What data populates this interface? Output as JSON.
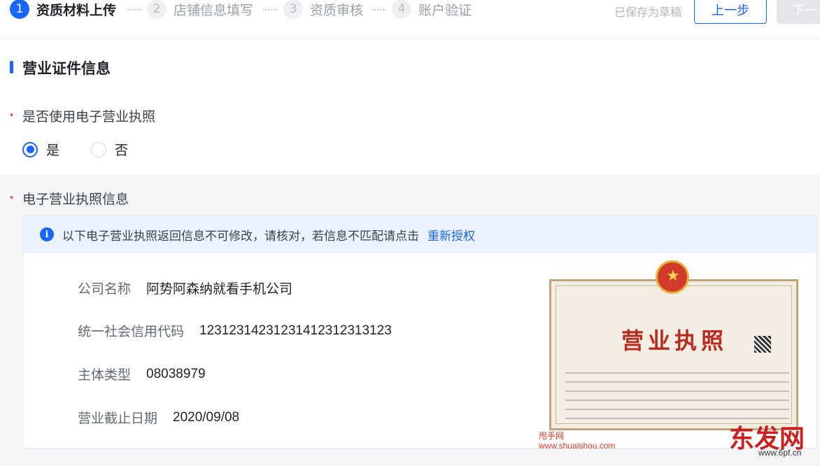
{
  "steps": [
    {
      "num": "1",
      "label": "资质材料上传"
    },
    {
      "num": "2",
      "label": "店铺信息填写"
    },
    {
      "num": "3",
      "label": "资质审核"
    },
    {
      "num": "4",
      "label": "账户验证"
    }
  ],
  "current_step": 1,
  "header": {
    "draft_text": "已保存为草稿",
    "prev_label": "上一步",
    "next_label": "下一"
  },
  "section": {
    "title": "营业证件信息"
  },
  "use_e_license": {
    "label": "是否使用电子营业执照",
    "options": [
      "是",
      "否"
    ],
    "selected": "是"
  },
  "license_info": {
    "label": "电子营业执照信息",
    "notice": "以下电子营业执照返回信息不可修改，请核对，若信息不匹配请点击",
    "notice_link": "重新授权",
    "fields": [
      {
        "key": "公司名称",
        "value": "阿势阿森纳就看手机公司"
      },
      {
        "key": "统一社会信用代码",
        "value": "12312314231231412312313123"
      },
      {
        "key": "主体类型",
        "value": "08038979"
      },
      {
        "key": "营业截止日期",
        "value": "2020/09/08"
      }
    ],
    "license_image_title": "营业执照"
  },
  "watermark": {
    "site_name": "甩手网",
    "site_url": "www.shuaishou.com",
    "logo_text": "东发网",
    "logo_url": "www.6pf.cn"
  },
  "colors": {
    "primary": "#1966ff",
    "required": "#f5564e"
  }
}
